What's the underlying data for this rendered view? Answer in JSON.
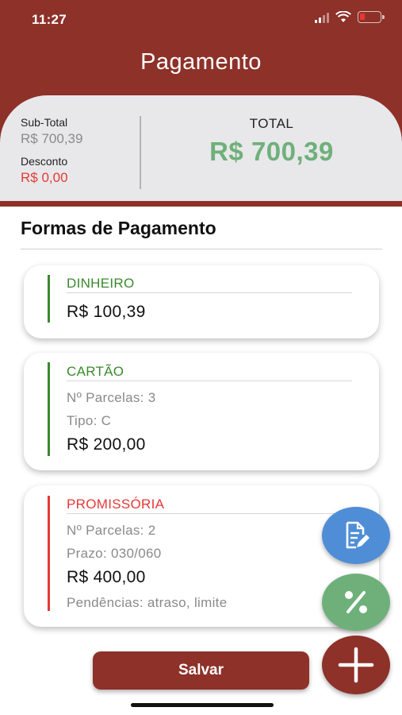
{
  "status_bar": {
    "time": "11:27",
    "icons": [
      "signal-icon",
      "wifi-icon",
      "battery-icon"
    ]
  },
  "header": {
    "title": "Pagamento"
  },
  "summary": {
    "subtotal_label": "Sub-Total",
    "subtotal_value": "R$ 700,39",
    "discount_label": "Desconto",
    "discount_value": "R$ 0,00",
    "total_label": "TOTAL",
    "total_value": "R$ 700,39"
  },
  "section": {
    "title": "Formas de Pagamento"
  },
  "payments": [
    {
      "name": "DINHEIRO",
      "amount": "R$ 100,39",
      "status_color": "#3a8a2c"
    },
    {
      "name": "CARTÃO",
      "installments": "Nº Parcelas: 3",
      "type": "Tipo: C",
      "amount": "R$ 200,00",
      "status_color": "#3a8a2c"
    },
    {
      "name": "PROMISSÓRIA",
      "installments": "Nº Parcelas: 2",
      "term": "Prazo: 030/060",
      "amount": "R$ 400,00",
      "pending": "Pendências: atraso, limite",
      "status_color": "#e53935"
    }
  ],
  "actions": {
    "edit_icon": "edit-document-icon",
    "discount_icon": "percent-icon",
    "add_icon": "plus-icon",
    "save_label": "Salvar"
  },
  "colors": {
    "brand": "#8e3129",
    "total": "#6fb07a",
    "ok": "#3a8a2c",
    "alert": "#e53935",
    "edit": "#4f8ed6"
  }
}
